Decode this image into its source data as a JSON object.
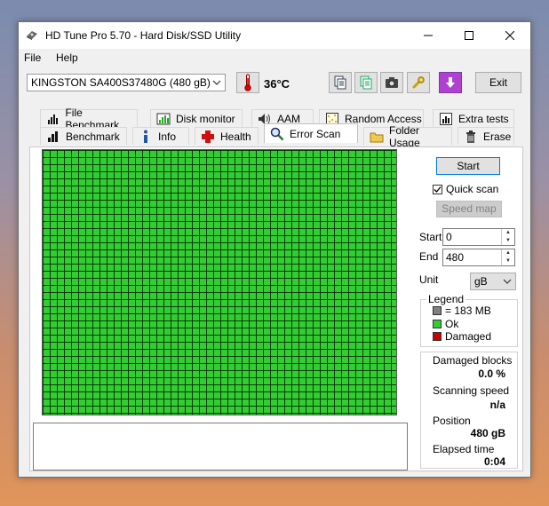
{
  "window": {
    "title": "HD Tune Pro 5.70 - Hard Disk/SSD Utility",
    "controls": {
      "minimize": "—",
      "maximize": "☐",
      "close": "✕"
    }
  },
  "menu": {
    "file": "File",
    "help": "Help"
  },
  "toolbar": {
    "drive": "KINGSTON SA400S37480G (480 gB)",
    "temperature": "36",
    "temperature_unit": "°C",
    "exit_label": "Exit"
  },
  "tabs": {
    "row1": [
      "File Benchmark",
      "Disk monitor",
      "AAM",
      "Random Access",
      "Extra tests"
    ],
    "row2": [
      "Benchmark",
      "Info",
      "Health",
      "Error Scan",
      "Folder Usage",
      "Erase"
    ],
    "active": "Error Scan"
  },
  "scan": {
    "start_button": "Start",
    "quick_scan_label": "Quick scan",
    "quick_scan_checked": true,
    "speed_map_button": "Speed map",
    "start_label": "Start",
    "start_value": "0",
    "end_label": "End",
    "end_value": "480",
    "unit_label": "Unit",
    "unit_value": "gB"
  },
  "legend": {
    "title": "Legend",
    "block_size": "= 183 MB",
    "ok": "Ok",
    "damaged": "Damaged",
    "colors": {
      "block": "#808080",
      "ok": "#33cc33",
      "damaged": "#cc0000"
    }
  },
  "stats": {
    "damaged_blocks_label": "Damaged blocks",
    "damaged_blocks_value": "0.0 %",
    "scanning_speed_label": "Scanning speed",
    "scanning_speed_value": "n/a",
    "position_label": "Position",
    "position_value": "480 gB",
    "elapsed_label": "Elapsed time",
    "elapsed_value": "0:04"
  }
}
